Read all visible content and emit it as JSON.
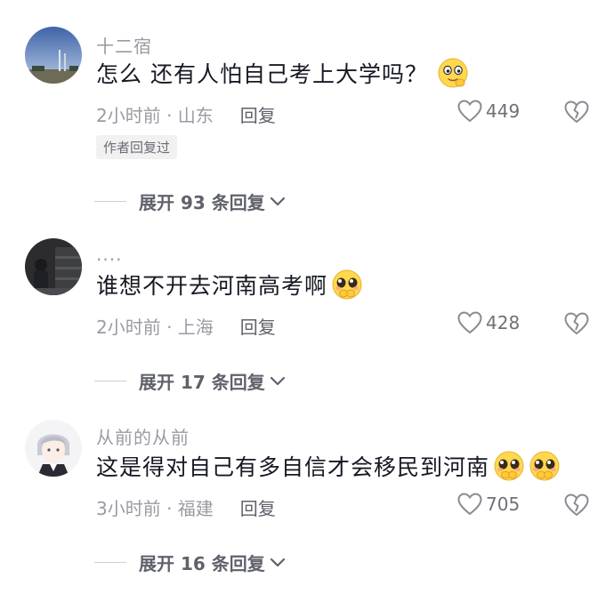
{
  "comments": [
    {
      "username": "十二宿",
      "text": "怎么  还有人怕自己考上大学吗？",
      "emojis": [
        "smile-emoji"
      ],
      "time_location": "2小时前 · 山东",
      "reply_label": "回复",
      "likes": "449",
      "badge": "作者回复过",
      "expand_label": "展开 93 条回复"
    },
    {
      "username": "....",
      "text": "谁想不开去河南高考啊",
      "emojis": [
        "pleading-emoji"
      ],
      "time_location": "2小时前 · 上海",
      "reply_label": "回复",
      "likes": "428",
      "expand_label": "展开 17 条回复"
    },
    {
      "username": "从前的从前",
      "text": "这是得对自己有多自信才会移民到河南",
      "emojis": [
        "pleading-emoji",
        "pleading-emoji"
      ],
      "time_location": "3小时前 · 福建",
      "reply_label": "回复",
      "likes": "705",
      "expand_label": "展开 16 条回复"
    }
  ],
  "colors": {
    "primary_text": "#161823",
    "secondary_text": "#9a9ba3",
    "action_text": "#5f616b"
  }
}
